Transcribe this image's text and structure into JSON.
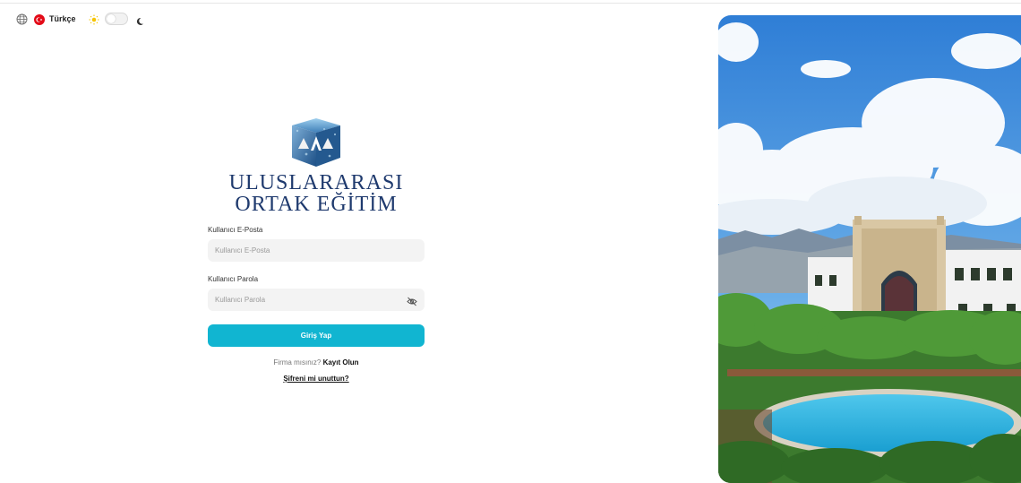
{
  "topbar": {
    "language_label": "Türkçe",
    "icons": [
      "globe-icon",
      "turkey-flag-icon",
      "sun-icon",
      "moon-icon"
    ],
    "theme_toggle": {
      "dark_mode": false
    }
  },
  "logo": {
    "line1": "ULUSLARARASI",
    "line2": "ORTAK EĞİTİM"
  },
  "form": {
    "email_label": "Kullanıcı E-Posta",
    "email_placeholder": "Kullanıcı E-Posta",
    "email_value": "",
    "password_label": "Kullanıcı Parola",
    "password_placeholder": "Kullanıcı Parola",
    "password_value": "",
    "submit_label": "Giriş Yap",
    "register_prompt": "Firma mısınız?",
    "register_link": "Kayıt Olun",
    "forgot_link": "Şifreni mi unuttun?"
  },
  "colors": {
    "accent": "#11b5d1",
    "logo_text": "#1f3a6e",
    "field_bg": "#f3f3f3"
  }
}
